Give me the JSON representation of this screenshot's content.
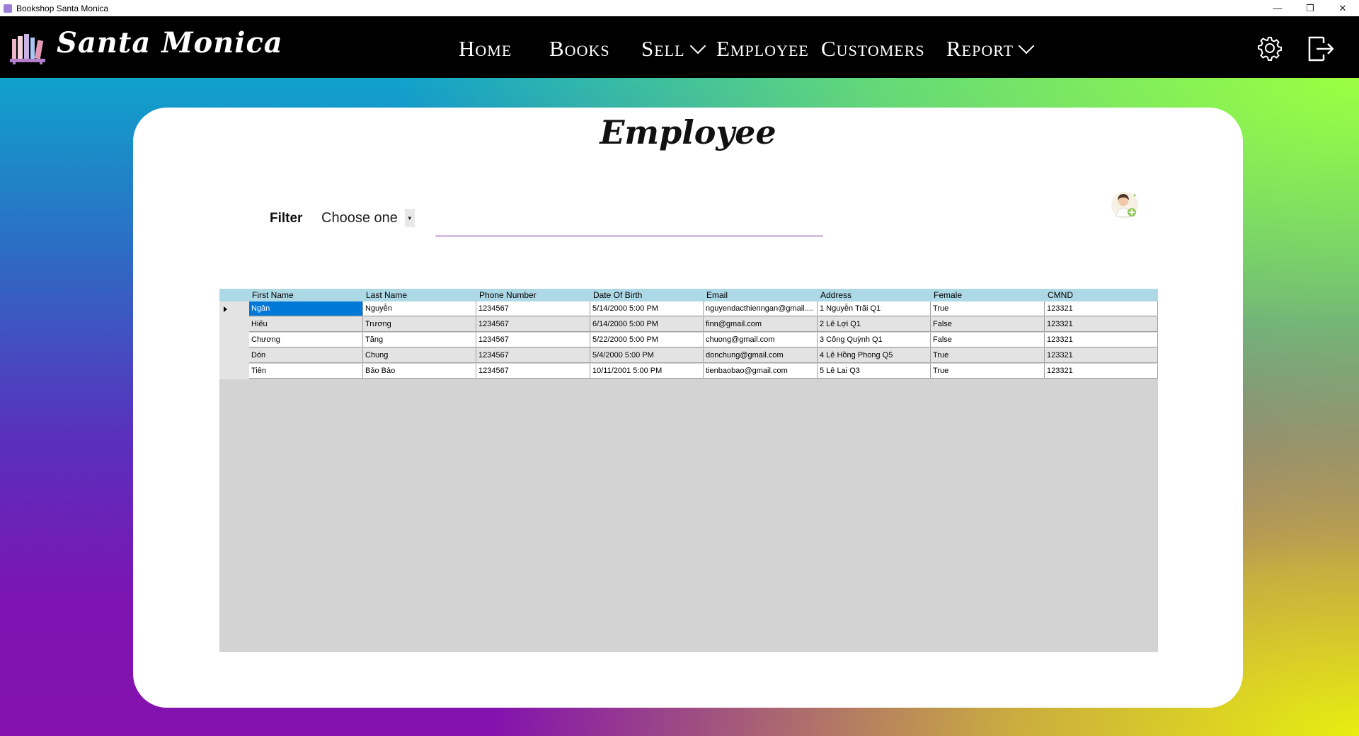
{
  "window": {
    "title": "Bookshop Santa Monica",
    "controls": {
      "minimize": "—",
      "restore": "❐",
      "close": "✕"
    }
  },
  "navbar": {
    "brand": "Santa Monica",
    "items": [
      {
        "label": "Home"
      },
      {
        "label": "Books"
      },
      {
        "label": "Sell",
        "dropdown": true
      },
      {
        "label": "Employee"
      },
      {
        "label": "Customers"
      },
      {
        "label": "Report",
        "dropdown": true
      }
    ],
    "icons": [
      "settings-gear-icon",
      "logout-icon"
    ]
  },
  "page": {
    "title": "Employee",
    "filter_label": "Filter",
    "filter_select_value": "Choose one",
    "add_employee_icon": "add-employee-avatar-icon"
  },
  "table": {
    "columns": [
      "First Name",
      "Last Name",
      "Phone Number",
      "Date Of Birth",
      "Email",
      "Address",
      "Female",
      "CMND"
    ],
    "rows": [
      [
        "Ngân",
        "Nguyễn",
        "1234567",
        "5/14/2000 5:00 PM",
        "nguyendacthienngan@gmail....",
        "1 Nguyễn Trãi Q1",
        "True",
        "123321"
      ],
      [
        "Hiếu",
        "Trương",
        "1234567",
        "6/14/2000 5:00 PM",
        "finn@gmail.com",
        "2 Lê Lợi Q1",
        "False",
        "123321"
      ],
      [
        "Chương",
        "Tăng",
        "1234567",
        "5/22/2000 5:00 PM",
        "chuong@gmail.com",
        "3 Công Quỳnh Q1",
        "False",
        "123321"
      ],
      [
        "Dón",
        "Chung",
        "1234567",
        "5/4/2000 5:00 PM",
        "donchung@gmail.com",
        "4 Lê Hồng Phong Q5",
        "True",
        "123321"
      ],
      [
        "Tiên",
        "Bảo Bảo",
        "1234567",
        "10/11/2001 5:00 PM",
        "tienbaobao@gmail.com",
        "5 Lê Lai Q3",
        "True",
        "123321"
      ]
    ],
    "selected_row": 0,
    "selected_col": 0
  },
  "colors": {
    "navbar_bg": "#000000",
    "header_row": "#add8e6",
    "selection": "#0078d7",
    "grid_empty": "#d3d3d3",
    "search_underline": "#d8bfe0"
  }
}
